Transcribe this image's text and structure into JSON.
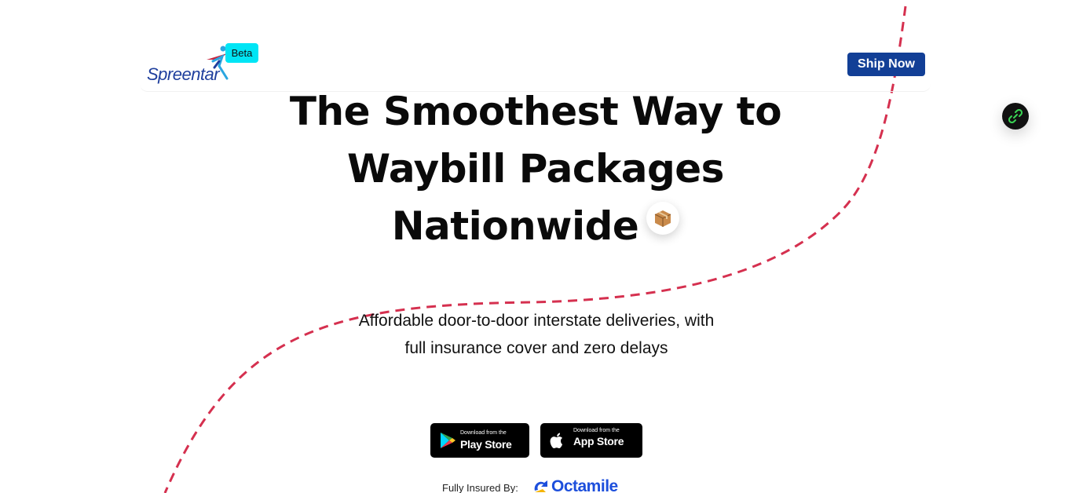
{
  "nav": {
    "logo_text": "Spreentar",
    "beta_label": "Beta",
    "cta_label": "Ship Now"
  },
  "hero": {
    "title_line1": "The Smoothest Way to",
    "title_line2": "Waybill Packages",
    "title_line3": "Nationwide",
    "title_icon": "package-icon",
    "subtitle": "Affordable door-to-door interstate deliveries, with full insurance cover and zero delays"
  },
  "downloads": {
    "play_small": "Download from the",
    "play_big": "Play Store",
    "app_small": "Download from the",
    "app_big": "App Store"
  },
  "insurance": {
    "label": "Fully Insured By:",
    "partner": "Octamile"
  },
  "floating_button": {
    "icon": "link-icon"
  },
  "colors": {
    "accent": "#123f96",
    "beta_badge": "#00e5f5",
    "dashed_path": "#d5304f",
    "partner_blue": "#1d4fdc"
  }
}
